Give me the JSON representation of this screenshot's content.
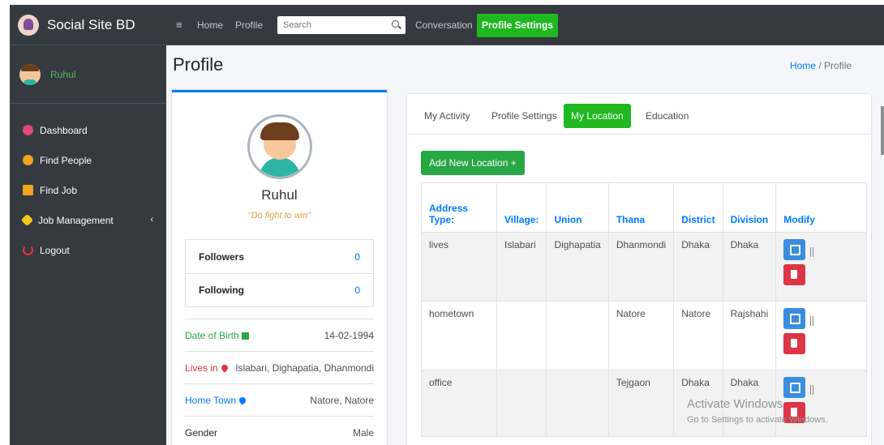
{
  "brand": {
    "title": "Social Site BD"
  },
  "user": {
    "name": "Ruhul"
  },
  "sidebar": {
    "items": [
      {
        "label": "Dashboard",
        "icon": "dashboard-icon"
      },
      {
        "label": "Find People",
        "icon": "user-icon"
      },
      {
        "label": "Find Job",
        "icon": "briefcase-icon"
      },
      {
        "label": "Job Management",
        "icon": "gear-icon"
      },
      {
        "label": "Logout",
        "icon": "power-icon"
      }
    ],
    "chevron": "‹"
  },
  "navbar": {
    "menu_icon": "≡",
    "home": "Home",
    "profile": "Profile",
    "search_placeholder": "Search",
    "conversation": "Conversation",
    "profile_settings": "Profile Settings"
  },
  "page": {
    "title": "Profile",
    "breadcrumb_home": "Home",
    "breadcrumb_sep": " / ",
    "breadcrumb_current": "Profile"
  },
  "profile": {
    "name": "Ruhul",
    "quote": "\"Do fight to win\"",
    "followers_label": "Followers",
    "followers_value": "0",
    "following_label": "Following",
    "following_value": "0",
    "dob_label": "Date of Birth",
    "dob_value": "14-02-1994",
    "lives_label": "Lives in",
    "lives_value": "Islabari, Dighapatia, Dhanmondi",
    "hometown_label": "Home Town",
    "hometown_value": "Natore, Natore",
    "gender_label": "Gender",
    "gender_value": "Male"
  },
  "tabs": {
    "items": [
      "My Activity",
      "Profile Settings",
      "My Location",
      "Education"
    ],
    "active": "My Location"
  },
  "location": {
    "add_button": "Add New Location +",
    "headers": [
      "Address Type:",
      "Village:",
      "Union",
      "Thana",
      "District",
      "Division",
      "Modify"
    ],
    "rows": [
      {
        "type": "lives",
        "village": "Islabari",
        "union": "Dighapatia",
        "thana": "Dhanmondi",
        "district": "Dhaka",
        "division": "Dhaka"
      },
      {
        "type": "hometown",
        "village": "",
        "union": "",
        "thana": "Natore",
        "district": "Natore",
        "division": "Rajshahi"
      },
      {
        "type": "office",
        "village": "",
        "union": "",
        "thana": "Tejgaon",
        "district": "Dhaka",
        "division": "Dhaka"
      }
    ]
  },
  "watermark": {
    "title": "Activate Windows",
    "subtitle": "Go to Settings to activate Windows."
  },
  "colors": {
    "sidebar": "#343a40",
    "accent_green": "#20b820",
    "link_blue": "#007bff",
    "danger": "#dc3545"
  }
}
